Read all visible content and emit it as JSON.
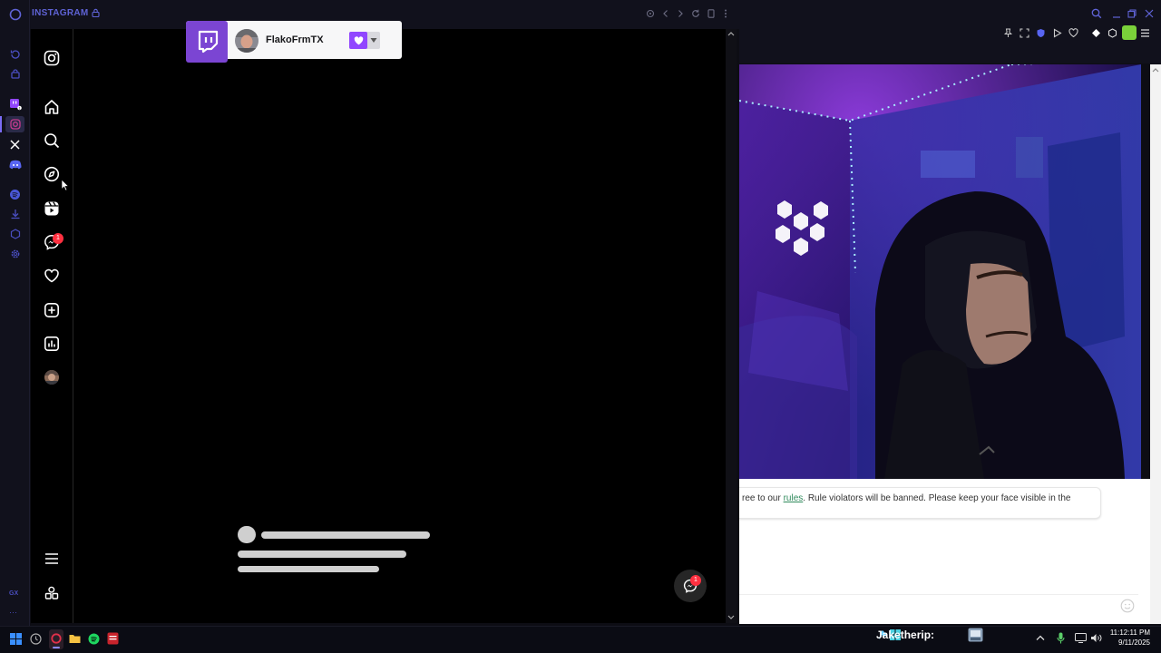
{
  "gx_sidebar": {
    "items": [
      {
        "name": "history",
        "icon": "history-icon"
      },
      {
        "name": "bag",
        "icon": "bag-icon"
      },
      {
        "name": "twitch",
        "icon": "twitch-icon"
      },
      {
        "name": "instagram",
        "icon": "instagram-icon"
      },
      {
        "name": "x",
        "icon": "x-icon"
      },
      {
        "name": "discord",
        "icon": "discord-icon"
      },
      {
        "name": "spotify",
        "icon": "spotify-icon"
      },
      {
        "name": "downloads",
        "icon": "download-icon"
      },
      {
        "name": "extensions",
        "icon": "cube-icon"
      },
      {
        "name": "settings",
        "icon": "gear-icon"
      }
    ],
    "gx_label": "GX",
    "more_label": "···"
  },
  "instagram_panel": {
    "title": "INSTAGRAM",
    "nav": [
      "instagram-logo-icon",
      "home-icon",
      "search-icon",
      "explore-icon",
      "reels-icon",
      "messenger-icon",
      "heart-icon",
      "create-icon",
      "dashboard-icon",
      "profile-avatar",
      "menu-icon",
      "apps-icon"
    ],
    "messenger_badge": "1",
    "fab_badge": "1"
  },
  "twitch_popup": {
    "username": "FlakoFrmTX"
  },
  "chat": {
    "rules_prefix": "ree to our ",
    "rules_link": "rules",
    "rules_suffix": ". Rule violators will be banned. Please keep your face visible in the"
  },
  "taskbar": {
    "ticker_text": "Jaketherip:",
    "time": "11:12:11 PM",
    "date": "9/11/2025"
  },
  "colors": {
    "accent": "#5f63d6",
    "twitch": "#7b45d3",
    "badge_red": "#ff3040",
    "spotify": "#1ed760"
  }
}
